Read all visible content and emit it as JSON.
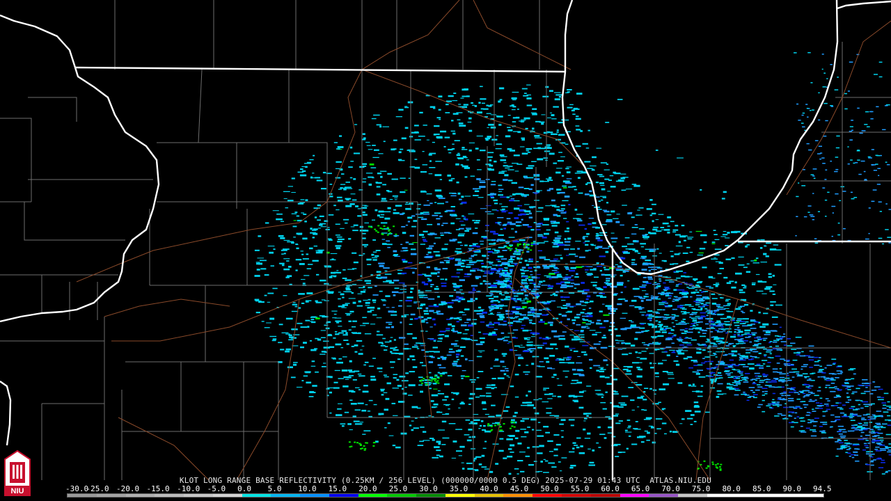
{
  "caption": "KLOT LONG RANGE BASE REFLECTIVITY (0.25KM / 256 LEVEL) (000000/0000 0.5 DEG) 2025-07-29 01:43 UTC  ATLAS.NIU.EDU",
  "scale": {
    "labels": [
      "-30.0",
      "-25.0",
      "-20.0",
      "-15.0",
      "-10.0",
      "-5.0",
      "0.0",
      "5.0",
      "10.0",
      "15.0",
      "20.0",
      "25.0",
      "30.0",
      "35.0",
      "40.0",
      "45.0",
      "50.0",
      "55.0",
      "60.0",
      "65.0",
      "70.0",
      "75.0",
      "80.0",
      "85.0",
      "90.0",
      "94.5"
    ],
    "colors": [
      "#9a9a9a",
      "#a4a4a4",
      "#b0b0b0",
      "#bcbcbc",
      "#c8c8c8",
      "#d4d4d4",
      "#00e3e3",
      "#00b5f0",
      "#0090ff",
      "#0000f0",
      "#00ff00",
      "#00c800",
      "#008c00",
      "#ffff00",
      "#e6c000",
      "#ff9000",
      "#ff0000",
      "#d40000",
      "#bc0000",
      "#ff00ff",
      "#9855c6",
      "#c8c8c8",
      "#ffffff",
      "#ffffff",
      "#ffffff",
      "#ffffff"
    ]
  },
  "colors": {
    "background": "#000000",
    "state_border": "#ffffff",
    "county_line": "#6e6e6e",
    "highway": "#8a4a2a",
    "echo_light": "#00d2ee",
    "echo_mid": "#1e9cff",
    "echo_heavy": "#0a2ae6",
    "echo_green": "#00e000"
  },
  "logo": {
    "text": "NIU",
    "color": "#c8102e"
  }
}
